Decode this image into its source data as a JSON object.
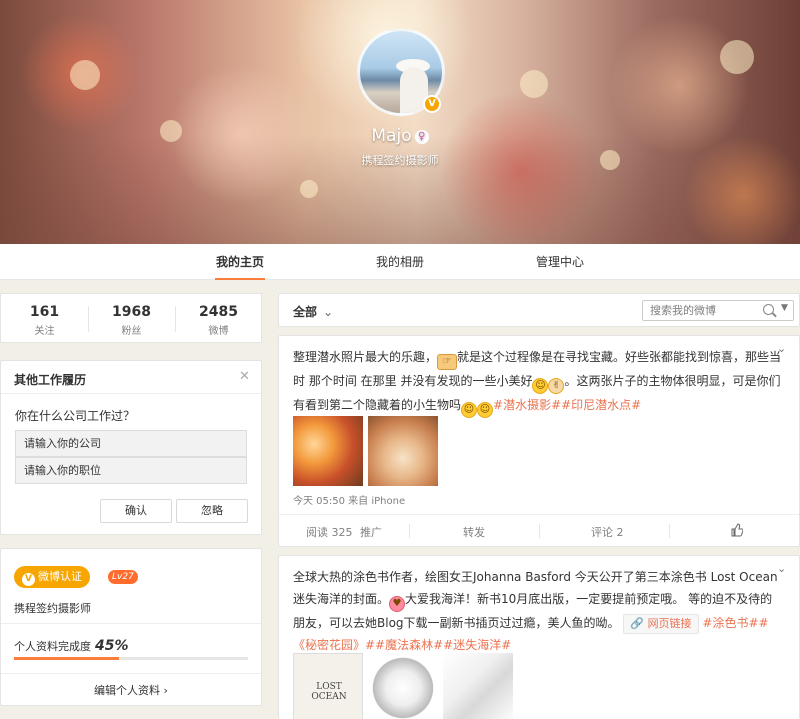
{
  "profile": {
    "name": "Majo",
    "title": "携程签约摄影师",
    "verify_mark": "V",
    "gender_mark": "♀"
  },
  "nav": {
    "tabs": [
      {
        "label": "我的主页",
        "active": true
      },
      {
        "label": "我的相册",
        "active": false
      },
      {
        "label": "管理中心",
        "active": false
      }
    ]
  },
  "stats": [
    {
      "value": "161",
      "label": "关注"
    },
    {
      "value": "1968",
      "label": "粉丝"
    },
    {
      "value": "2485",
      "label": "微博"
    }
  ],
  "work": {
    "title": "其他工作履历",
    "question": "你在什么公司工作过？",
    "company_placeholder": "请输入你的公司",
    "position_placeholder": "请输入你的职位",
    "confirm_label": "确认",
    "ignore_label": "忽略"
  },
  "profile_card": {
    "verify_label": "微博认证",
    "level": "Lv27",
    "title": "携程签约摄影师",
    "completion_label": "个人资料完成度",
    "completion_value": "45%",
    "completion_fraction": 0.45,
    "edit_label": "编辑个人资料"
  },
  "filter": {
    "all_label": "全部",
    "search_placeholder": "搜索我的微博"
  },
  "posts": [
    {
      "text_1": "整理潜水照片最大的乐趣，",
      "text_2": "就是这个过程像是在寻找宝藏。好些张都能找到惊喜，那些当时 那个时间 在那里 并没有发现的一些小美好",
      "text_3": "。这两张片子的主物体很明显，可是你们有看到第二个隐藏着的小生物吗",
      "hashtags": "#潜水摄影##印尼潜水点#",
      "meta": "今天 05:50 来自 iPhone",
      "reads": "阅读 325",
      "promote": "推广",
      "repost": "转发",
      "comment": "评论 2"
    },
    {
      "text_1": "全球大热的涂色书作者，绘图女王Johanna Basford 今天公开了第三本涂色书 Lost Ocean 迷失海洋的封面。",
      "text_2": "大爱我海洋！新书10月底出版，一定要提前预定哦。 等的迫不及待的朋友，可以去她Blog下载一副新书插页过过瘾，美人鱼的呦。",
      "link_label": "网页链接",
      "hashtags": "#涂色书##《秘密花园》##魔法森林##迷失海洋#",
      "book_title": "LOST OCEAN"
    }
  ],
  "colors": {
    "accent": "#fa7d3c",
    "link": "#eb7350",
    "verify": "#f7a600",
    "level": "#ff6c2d"
  }
}
